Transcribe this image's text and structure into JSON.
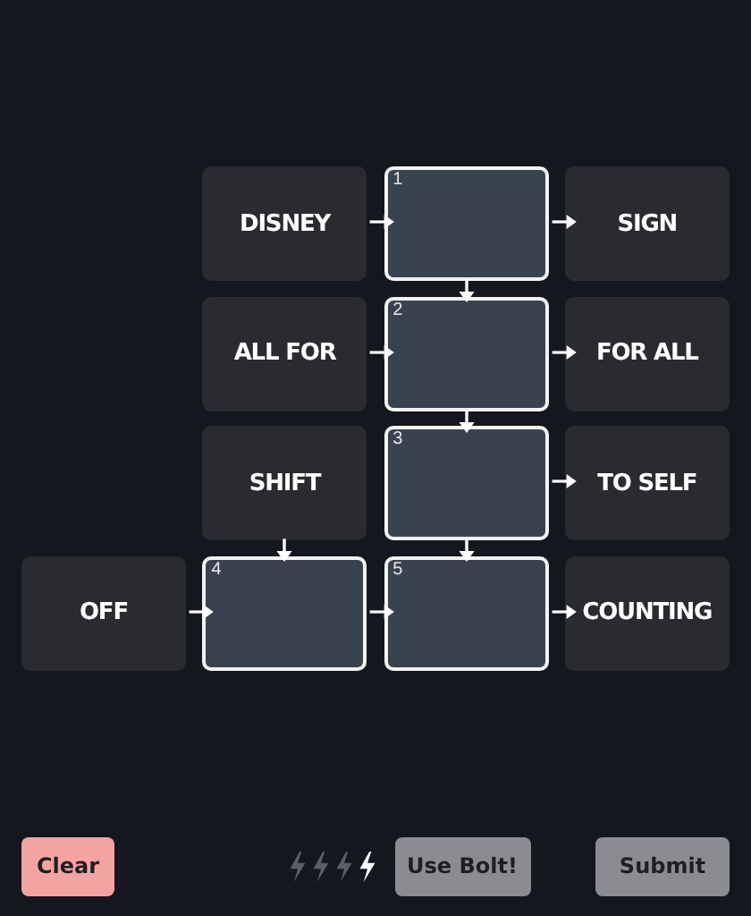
{
  "grid": [
    [
      {
        "kind": "empty"
      },
      {
        "kind": "clue",
        "text": "DISNEY",
        "arrow_right": true
      },
      {
        "kind": "slot",
        "number": "1",
        "arrow_right": true,
        "arrow_down": true
      },
      {
        "kind": "clue",
        "text": "SIGN"
      }
    ],
    [
      {
        "kind": "empty"
      },
      {
        "kind": "clue",
        "text": "ALL FOR",
        "arrow_right": true
      },
      {
        "kind": "slot",
        "number": "2",
        "arrow_right": true,
        "arrow_down": true
      },
      {
        "kind": "clue",
        "text": "FOR ALL"
      }
    ],
    [
      {
        "kind": "empty"
      },
      {
        "kind": "clue",
        "text": "SHIFT",
        "arrow_down": true
      },
      {
        "kind": "slot",
        "number": "3",
        "arrow_right": true,
        "arrow_down": true
      },
      {
        "kind": "clue",
        "text": "TO SELF"
      }
    ],
    [
      {
        "kind": "clue",
        "text": "OFF",
        "arrow_right": true
      },
      {
        "kind": "slot",
        "number": "4",
        "arrow_right": true
      },
      {
        "kind": "slot",
        "number": "5",
        "arrow_right": true
      },
      {
        "kind": "clue",
        "text": "COUNTING"
      }
    ]
  ],
  "clear_button": "Clear",
  "bolts": [
    {
      "used": true
    },
    {
      "used": true
    },
    {
      "used": true
    },
    {
      "used": false
    }
  ],
  "bolt_button": "Use Bolt!",
  "submit_button": "Submit"
}
